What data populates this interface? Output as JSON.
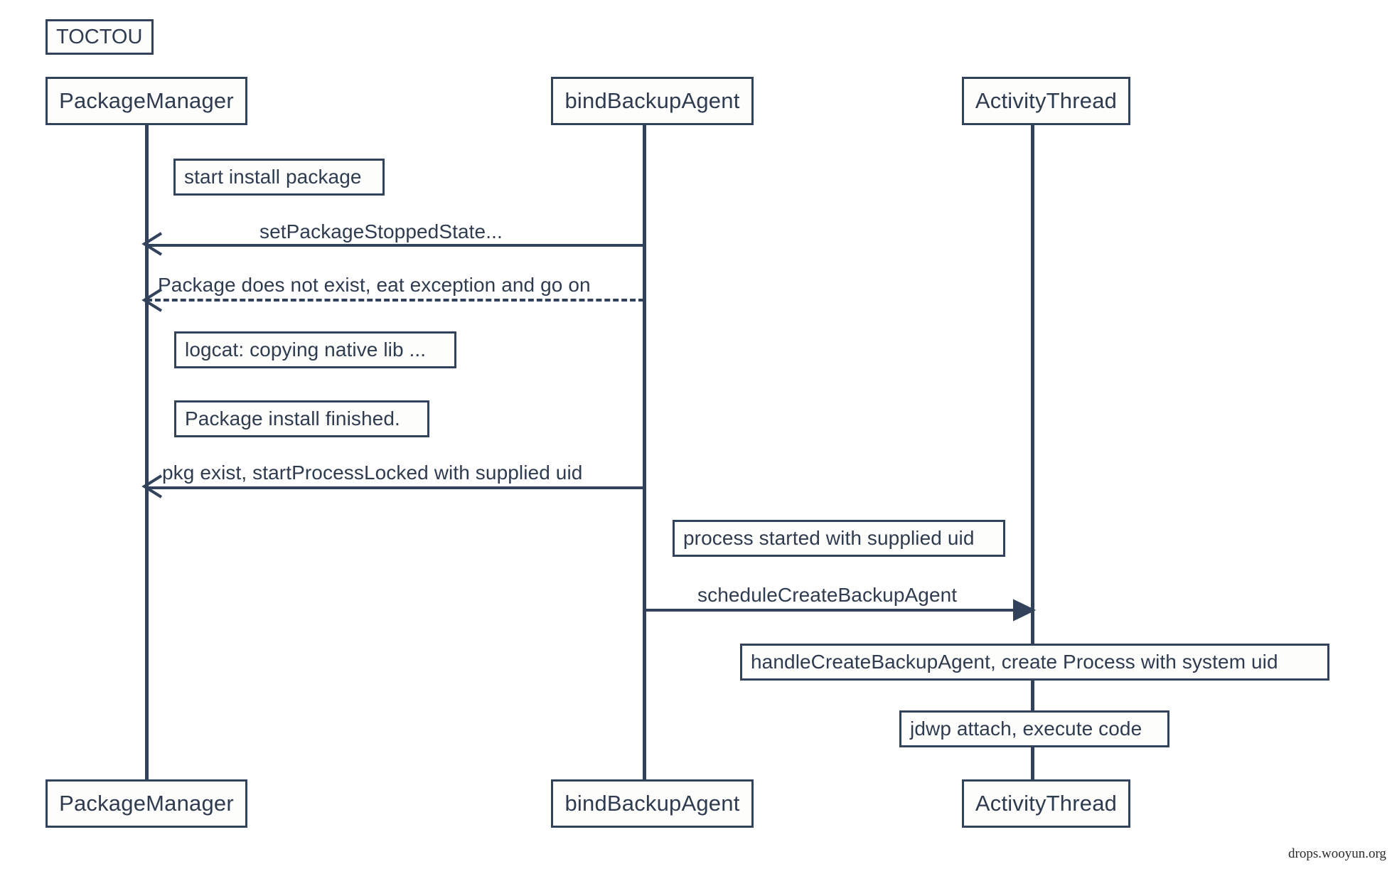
{
  "diagram": {
    "kind": "uml-sequence-diagram",
    "title": "TOCTOU",
    "colors": {
      "stroke": "#33425b",
      "text": "#2f3b4f",
      "background": "#ffffff",
      "note_fill": "#fdfdfc"
    },
    "participants": [
      {
        "id": "pm",
        "label": "PackageManager"
      },
      {
        "id": "bba",
        "label": "bindBackupAgent"
      },
      {
        "id": "at",
        "label": "ActivityThread"
      }
    ],
    "participants_bottom": [
      {
        "id": "pm",
        "label": "PackageManager"
      },
      {
        "id": "bba",
        "label": "bindBackupAgent"
      },
      {
        "id": "at",
        "label": "ActivityThread"
      }
    ],
    "notes": [
      {
        "id": "note-start-install",
        "text": "start install package"
      },
      {
        "id": "note-logcat",
        "text": "logcat: copying native lib ..."
      },
      {
        "id": "note-install-finished",
        "text": "Package install finished."
      },
      {
        "id": "note-process-started",
        "text": "process started with supplied uid"
      },
      {
        "id": "note-handle-create",
        "text": "handleCreateBackupAgent, create Process with system uid"
      },
      {
        "id": "note-jdwp",
        "text": "jdwp attach, execute code"
      }
    ],
    "messages": [
      {
        "id": "msg-set-package-stopped-state",
        "label": "setPackageStoppedState...",
        "from": "bba",
        "to": "pm",
        "direction": "right-to-left",
        "style": "solid"
      },
      {
        "id": "msg-package-does-not-exist",
        "label": "Package does not exist, eat exception and go on",
        "from": "bba",
        "to": "pm",
        "direction": "right-to-left",
        "style": "dashed"
      },
      {
        "id": "msg-pkg-exist-start-process",
        "label": "pkg exist, startProcessLocked with supplied uid",
        "from": "bba",
        "to": "pm",
        "direction": "right-to-left",
        "style": "solid"
      },
      {
        "id": "msg-schedule-create-backup-agent",
        "label": "scheduleCreateBackupAgent",
        "from": "bba",
        "to": "at",
        "direction": "left-to-right",
        "style": "solid"
      }
    ],
    "watermark": "drops.wooyun.org"
  }
}
